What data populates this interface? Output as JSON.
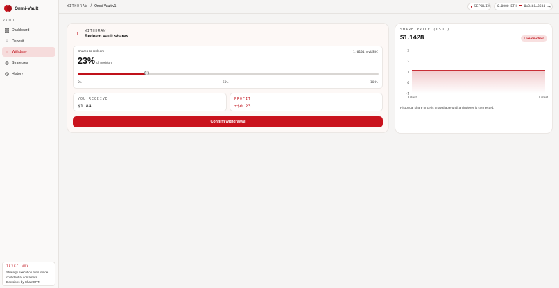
{
  "app": {
    "brand": "Omni-Vault",
    "accent": "#c0111a"
  },
  "sidebar": {
    "section_label": "VAULT",
    "items": [
      {
        "label": "Dashboard",
        "icon": "grid-icon",
        "active": false
      },
      {
        "label": "Deposit",
        "icon": "arrow-down-icon",
        "active": false
      },
      {
        "label": "Withdraw",
        "icon": "arrow-up-icon",
        "active": true
      },
      {
        "label": "Strategies",
        "icon": "layers-icon",
        "active": false
      },
      {
        "label": "History",
        "icon": "history-icon",
        "active": false
      }
    ],
    "tee": {
      "title": "IEXEC NOX",
      "text_lines": [
        "Strategy execution runs inside",
        "confidential containers.",
        "Decisions by ChainGPT."
      ]
    }
  },
  "topbar": {
    "breadcrumb_section": "WITHDRAW",
    "breadcrumb_separator": "/",
    "breadcrumb_page": "Omni-Vault v1",
    "network": "SEPOLIA",
    "balance": "0.0000 ETH",
    "address": "0x3468…35D4"
  },
  "withdraw": {
    "eyebrow": "WITHDRAW",
    "title": "Redeem vault shares",
    "shares_label": "Shares to redeem",
    "shares_amount": "1.0101 mvUSDC",
    "percent_display": "23%",
    "percent_value": 23,
    "percent_suffix": "of position",
    "ticks": [
      "0%",
      "50%",
      "100%"
    ],
    "receive_label": "YOU RECEIVE",
    "receive_value": "$1.84",
    "profit_label": "PROFIT",
    "profit_value": "+$0.23",
    "confirm_label": "Confirm withdrawal"
  },
  "price": {
    "label": "SHARE PRICE (USDC)",
    "value": "$1.1428",
    "badge": "Live on-chain",
    "note": "Historical share price is unavailable until an indexer is connected."
  },
  "chart_data": {
    "type": "area",
    "y_ticks": [
      "3",
      "2",
      "1",
      "0",
      "-1"
    ],
    "ylim": [
      -1,
      3
    ],
    "x_labels": [
      "Latest",
      "Latest"
    ],
    "series": [
      {
        "values": [
          1.1428,
          1.1428
        ]
      }
    ]
  }
}
